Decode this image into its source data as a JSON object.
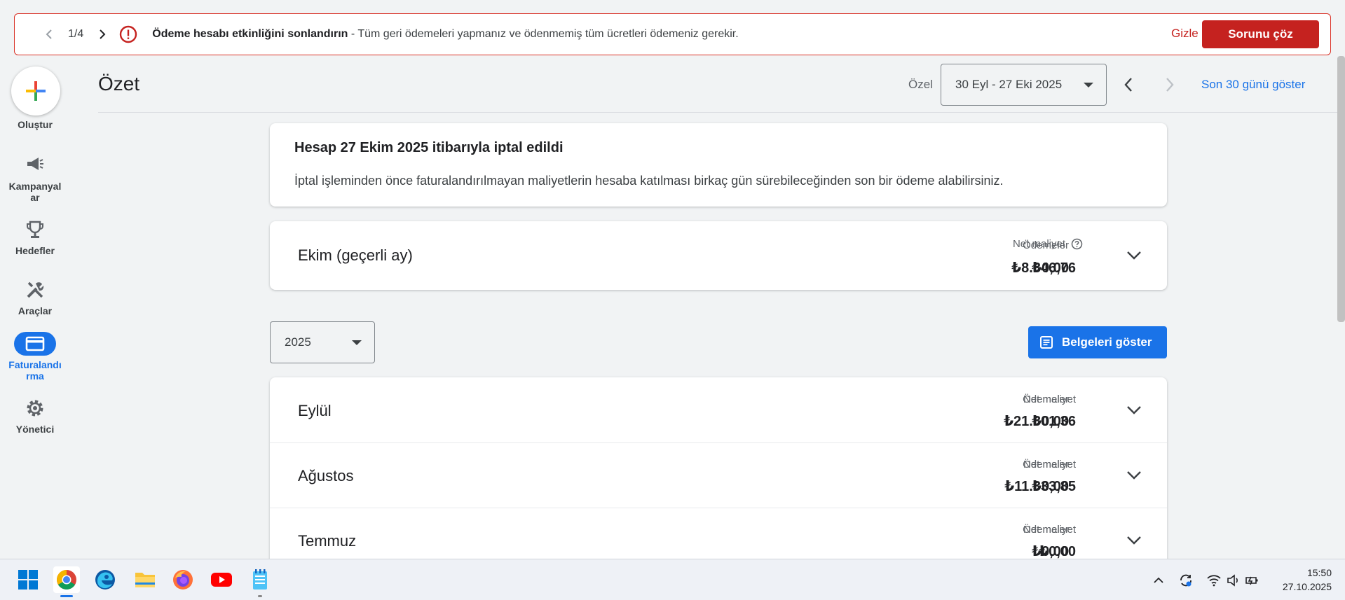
{
  "alert": {
    "counter": "1/4",
    "title": "Ödeme hesabı etkinliğini sonlandırın",
    "message": " - Tüm geri ödemeleri yapmanız ve ödenmemiş tüm ücretleri ödemeniz gerekir.",
    "hide_label": "Gizle",
    "fix_label": "Sorunu çöz",
    "color": "#c5221f"
  },
  "sidebar": {
    "create_label": "Oluştur",
    "items": [
      {
        "label": "Kampanyal\nar",
        "icon": "megaphone-icon"
      },
      {
        "label": "Hedefler",
        "icon": "trophy-icon"
      },
      {
        "label": "Araçlar",
        "icon": "tools-icon"
      },
      {
        "label": "Faturalandı\nrma",
        "icon": "credit-card-icon",
        "active": true
      },
      {
        "label": "Yönetici",
        "icon": "gear-icon"
      }
    ],
    "accent": "#1a73e8"
  },
  "header": {
    "title": "Özet",
    "range_label": "Özel",
    "date_range": "30 Eyl - 27 Eki 2025",
    "last30_label": "Son 30 günü göster"
  },
  "notice": {
    "title": "Hesap 27 Ekim 2025 itibarıyla iptal edildi",
    "body": "İptal işleminden önce faturalandırılmayan maliyetlerin hesaba katılması birkaç gün sürebileceğinden son bir ödeme alabilirsiniz."
  },
  "current_month": {
    "name": "Ekim (geçerli ay)",
    "net_cost_label": "Net maliyet",
    "net_cost": "₺8.346,76",
    "payments_label": "Ödemeler",
    "payments": "₺0,00"
  },
  "year_select": "2025",
  "docs_button": "Belgeleri göster",
  "months": [
    {
      "name": "Eylül",
      "net_cost_label": "Net maliyet",
      "net_cost": "₺21.801,36",
      "payments_label": "Ödemeler",
      "payments": "₺0,00"
    },
    {
      "name": "Ağustos",
      "net_cost_label": "Net maliyet",
      "net_cost": "₺11.333,85",
      "payments_label": "Ödemeler",
      "payments": "₺0,00"
    },
    {
      "name": "Temmuz",
      "net_cost_label": "Net maliyet",
      "net_cost": "₺0,00",
      "payments_label": "Ödemeler",
      "payments": "₺0,00"
    }
  ],
  "taskbar": {
    "apps": [
      "windows-start-icon",
      "chrome-icon",
      "edge-icon",
      "file-explorer-icon",
      "firefox-icon",
      "youtube-icon",
      "notepad-icon"
    ],
    "time": "15:50",
    "date": "27.10.2025"
  }
}
